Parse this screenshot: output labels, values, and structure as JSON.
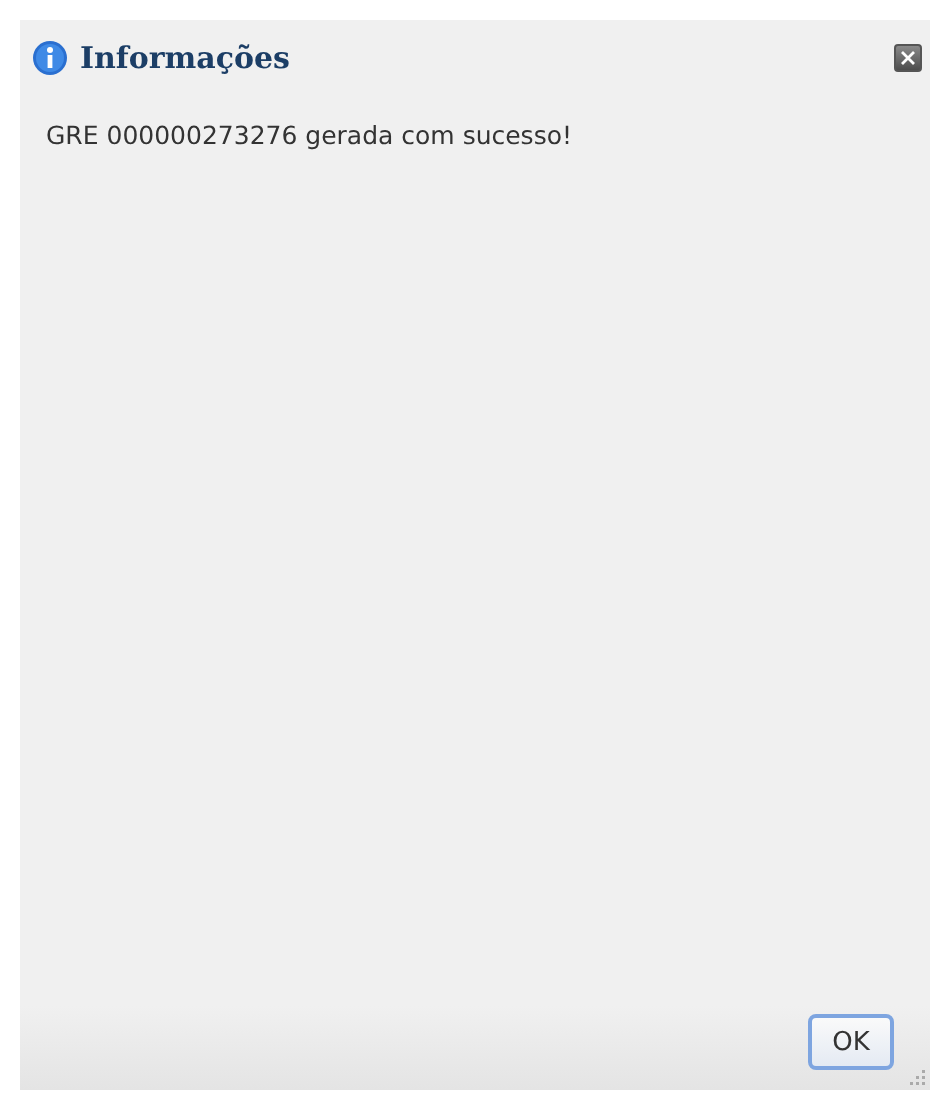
{
  "dialog": {
    "title": "Informações",
    "message": "GRE 000000273276 gerada com sucesso!",
    "buttons": [
      "OK"
    ]
  }
}
